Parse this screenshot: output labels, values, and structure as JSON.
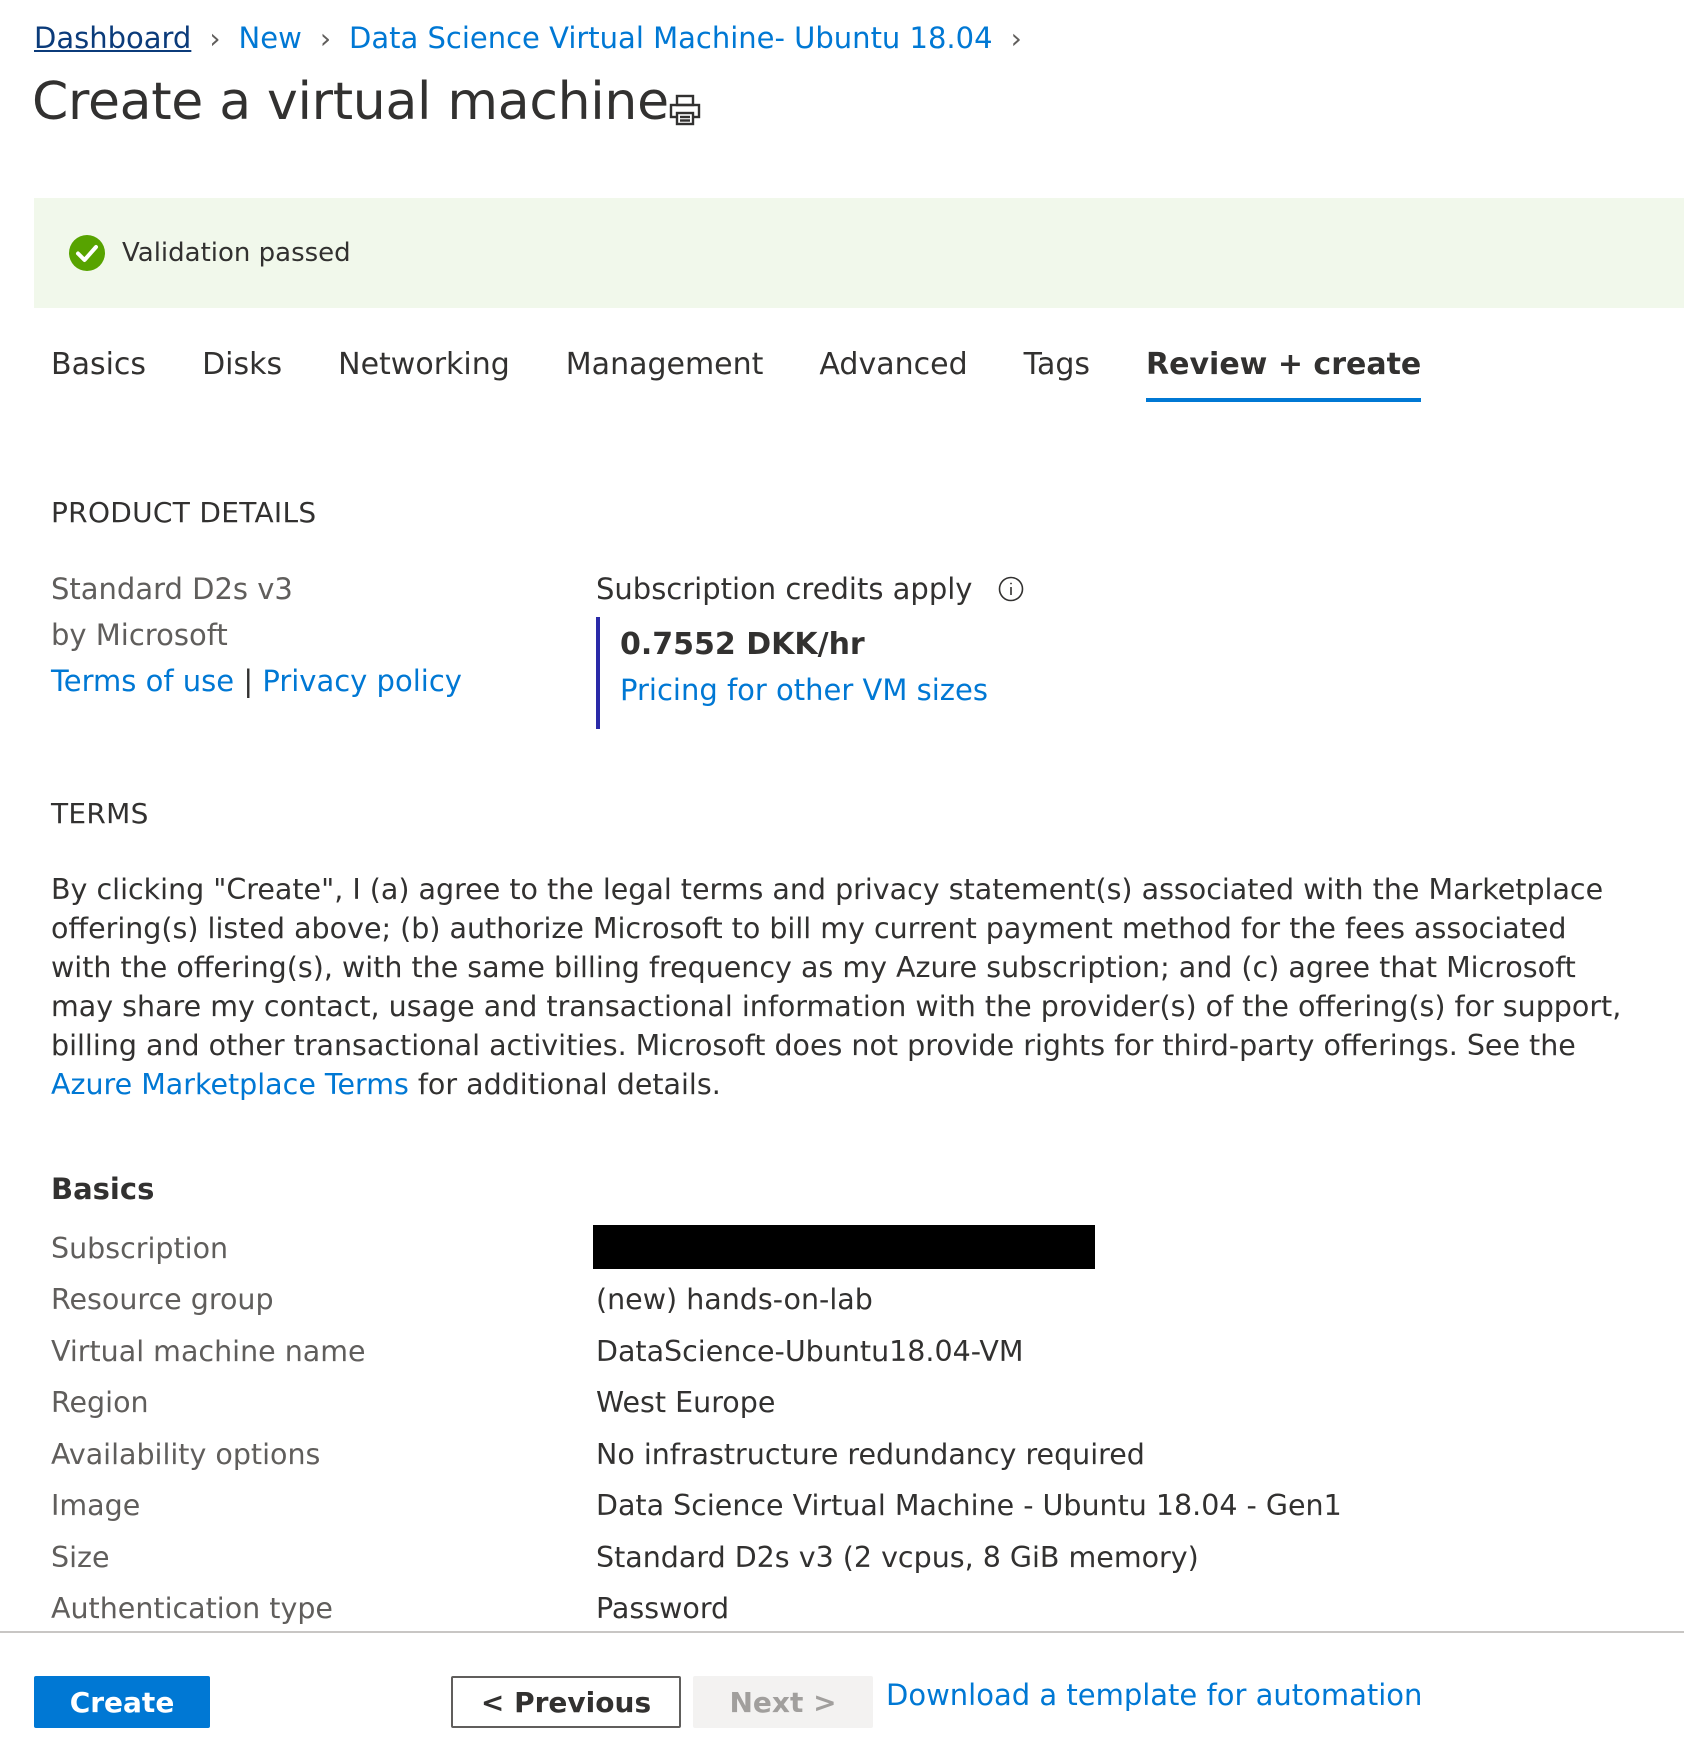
{
  "breadcrumb": {
    "items": [
      "Dashboard",
      "New",
      "Data Science Virtual Machine- Ubuntu 18.04"
    ],
    "separator": ">"
  },
  "page": {
    "title": "Create a virtual machine",
    "print_icon": "print-icon"
  },
  "banner": {
    "message": "Validation passed",
    "icon": "check-circle-icon",
    "status_color": "#57a300"
  },
  "tabs": [
    {
      "label": "Basics",
      "active": false
    },
    {
      "label": "Disks",
      "active": false
    },
    {
      "label": "Networking",
      "active": false
    },
    {
      "label": "Management",
      "active": false
    },
    {
      "label": "Advanced",
      "active": false
    },
    {
      "label": "Tags",
      "active": false
    },
    {
      "label": "Review + create",
      "active": true
    }
  ],
  "product": {
    "heading": "PRODUCT DETAILS",
    "name": "Standard D2s v3",
    "publisher": "by Microsoft",
    "terms_link": "Terms of use",
    "link_separator": "|",
    "privacy_link": "Privacy policy",
    "credits_label": "Subscription credits apply",
    "info_icon": "info-icon",
    "price": "0.7552 DKK/hr",
    "pricing_link": "Pricing for other VM sizes"
  },
  "terms": {
    "heading": "TERMS",
    "text_before": "By clicking \"Create\", I (a) agree to the legal terms and privacy statement(s) associated with the Marketplace offering(s) listed above; (b) authorize Microsoft to bill my current payment method for the fees associated with the offering(s), with the same billing frequency as my Azure subscription; and (c) agree that Microsoft may share my contact, usage and transactional information with the provider(s) of the offering(s) for support, billing and other transactional activities. Microsoft does not provide rights for third-party offerings. See the ",
    "link": "Azure Marketplace Terms",
    "text_after": " for additional details."
  },
  "basics": {
    "heading": "Basics",
    "rows": [
      {
        "key": "Subscription",
        "value": ""
      },
      {
        "key": "Resource group",
        "value": "(new) hands-on-lab"
      },
      {
        "key": "Virtual machine name",
        "value": "DataScience-Ubuntu18.04-VM"
      },
      {
        "key": "Region",
        "value": "West Europe"
      },
      {
        "key": "Availability options",
        "value": "No infrastructure redundancy required"
      },
      {
        "key": "Image",
        "value": "Data Science Virtual Machine - Ubuntu 18.04 - Gen1"
      },
      {
        "key": "Size",
        "value": "Standard D2s v3 (2 vcpus, 8 GiB memory)"
      },
      {
        "key": "Authentication type",
        "value": "Password"
      }
    ]
  },
  "footer": {
    "create_label": "Create",
    "previous_label": "< Previous",
    "next_label": "Next >",
    "download_link": "Download a template for automation"
  },
  "colors": {
    "accent": "#0078d4",
    "banner_bg": "#f1f8eb",
    "price_border": "#2a2aa8"
  }
}
